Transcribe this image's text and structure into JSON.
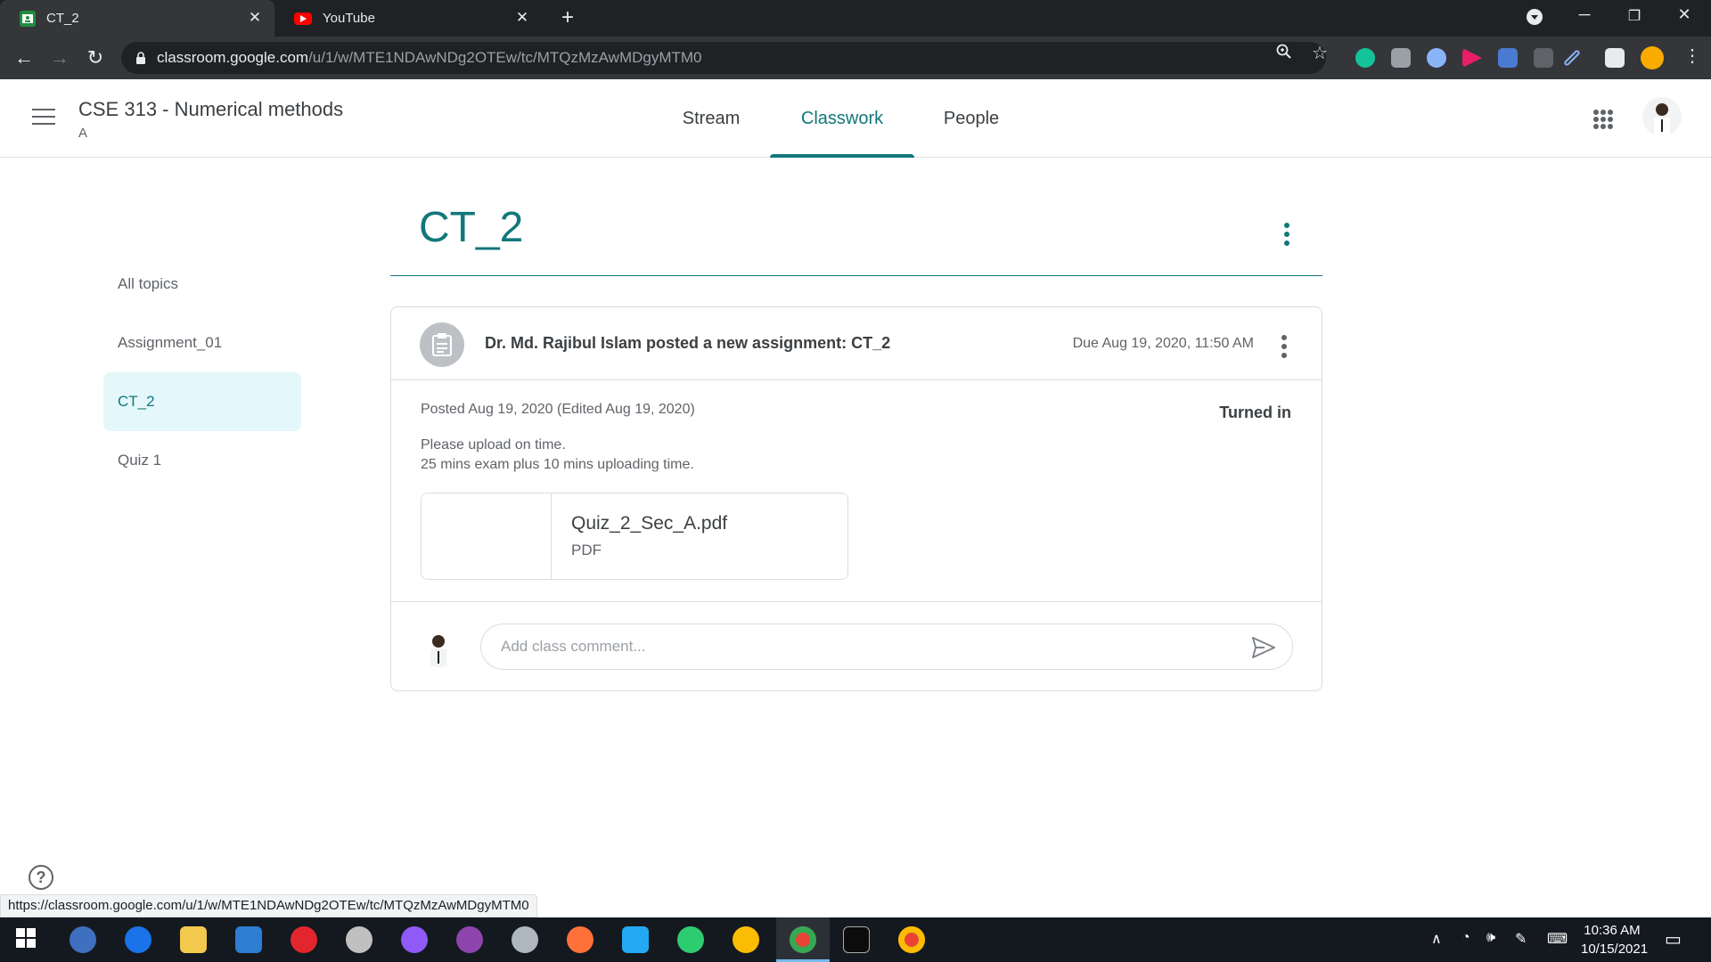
{
  "browser": {
    "tabs": [
      {
        "title": "CT_2",
        "active": true,
        "favicon": "classroom-icon"
      },
      {
        "title": "YouTube",
        "active": false,
        "favicon": "youtube-icon"
      }
    ],
    "url_host": "classroom.google.com",
    "url_path": "/u/1/w/MTE1NDAwNDg2OTEw/tc/MTQzMzAwMDgyMTM0",
    "status_url": "https://classroom.google.com/u/1/w/MTE1NDAwNDg2OTEw/tc/MTQzMzAwMDgyMTM0"
  },
  "classroom": {
    "class_title": "CSE 313 - Numerical methods",
    "section": "A",
    "nav": [
      "Stream",
      "Classwork",
      "People"
    ],
    "active_nav": "Classwork",
    "accent": "#12777a"
  },
  "topics": [
    "All topics",
    "Assignment_01",
    "CT_2",
    "Quiz 1"
  ],
  "selected_topic": "CT_2",
  "main": {
    "topic_heading": "CT_2",
    "assignment": {
      "title": "Dr. Md. Rajibul Islam posted a new assignment: CT_2",
      "due": "Due Aug 19, 2020, 11:50 AM",
      "posted": "Posted Aug 19, 2020 (Edited Aug 19, 2020)",
      "status": "Turned in",
      "description_lines": [
        "Please upload on time.",
        "25 mins exam plus 10 mins uploading time."
      ],
      "attachment": {
        "name": "Quiz_2_Sec_A.pdf",
        "type": "PDF"
      },
      "comment_placeholder": "Add class comment..."
    }
  },
  "taskbar": {
    "time": "10:36 AM",
    "date": "10/15/2021"
  }
}
